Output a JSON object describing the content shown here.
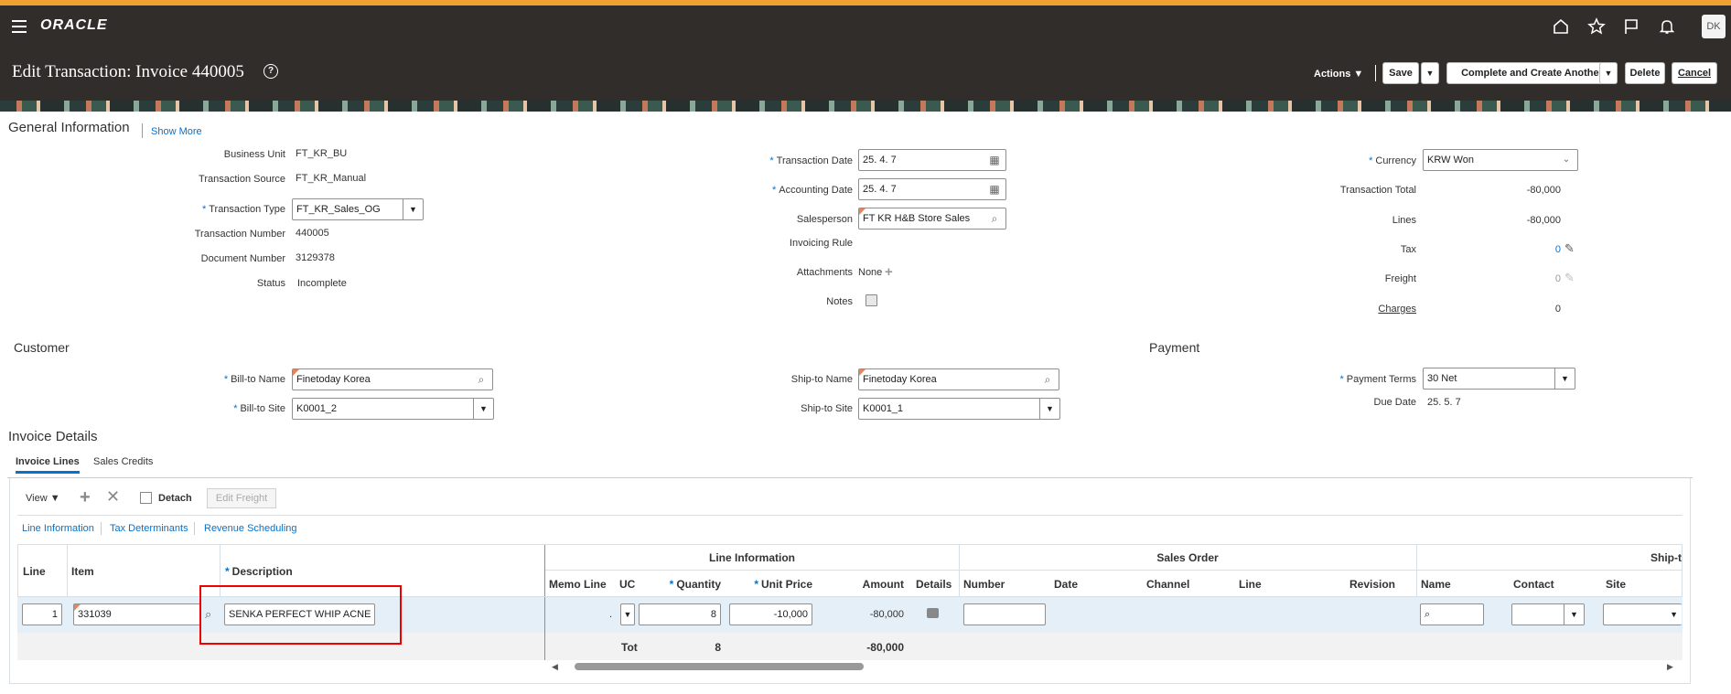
{
  "nav": {
    "logo": "ORACLE",
    "avatar": "DK",
    "icons": [
      "home-icon",
      "star-icon",
      "flag-icon",
      "bell-icon"
    ]
  },
  "header": {
    "title": "Edit Transaction: Invoice 440005",
    "help_glyph": "?",
    "actions_label": "Actions ▼",
    "save": "Save",
    "complete_create": "Complete and Create Another",
    "delete": "Delete",
    "cancel": "Cancel"
  },
  "general": {
    "heading": "General Information",
    "show_more": "Show More",
    "business_unit_label": "Business Unit",
    "business_unit": "FT_KR_BU",
    "transaction_source_label": "Transaction Source",
    "transaction_source": "FT_KR_Manual",
    "transaction_type_label": "Transaction Type",
    "transaction_type": "FT_KR_Sales_OG",
    "transaction_number_label": "Transaction Number",
    "transaction_number": "440005",
    "document_number_label": "Document Number",
    "document_number": "3129378",
    "status_label": "Status",
    "status": "Incomplete",
    "transaction_date_label": "Transaction Date",
    "transaction_date": "25. 4. 7",
    "accounting_date_label": "Accounting Date",
    "accounting_date": "25. 4. 7",
    "salesperson_label": "Salesperson",
    "salesperson": "FT KR H&B Store Sales",
    "invoicing_rule_label": "Invoicing Rule",
    "attachments_label": "Attachments",
    "attachments": "None",
    "notes_label": "Notes",
    "currency_label": "Currency",
    "currency": "KRW Won",
    "transaction_total_label": "Transaction Total",
    "transaction_total": "-80,000",
    "lines_label": "Lines",
    "lines": "-80,000",
    "tax_label": "Tax",
    "tax": "0",
    "freight_label": "Freight",
    "freight": "0",
    "charges_label": "Charges",
    "charges": "0"
  },
  "customer": {
    "heading": "Customer",
    "bill_to_name_label": "Bill-to Name",
    "bill_to_name": "Finetoday Korea",
    "bill_to_site_label": "Bill-to Site",
    "bill_to_site": "K0001_2",
    "ship_to_name_label": "Ship-to Name",
    "ship_to_name": "Finetoday Korea",
    "ship_to_site_label": "Ship-to Site",
    "ship_to_site": "K0001_1"
  },
  "payment": {
    "heading": "Payment",
    "terms_label": "Payment Terms",
    "terms": "30 Net",
    "due_date_label": "Due Date",
    "due_date": "25. 5. 7"
  },
  "details": {
    "heading": "Invoice Details",
    "tabs": [
      "Invoice Lines",
      "Sales Credits"
    ],
    "view": "View ▼",
    "detach": "Detach",
    "edit_freight": "Edit Freight",
    "links": [
      "Line Information",
      "Tax Determinants",
      "Revenue Scheduling"
    ],
    "groups": {
      "line_information": "Line Information",
      "sales_order": "Sales Order",
      "ship_to": "Ship-t"
    },
    "columns": {
      "line": "Line",
      "item": "Item",
      "description": "Description",
      "memo_line": "Memo Line",
      "uom": "UC",
      "quantity": "Quantity",
      "unit_price": "Unit Price",
      "amount": "Amount",
      "details": "Details",
      "number": "Number",
      "date": "Date",
      "channel": "Channel",
      "so_line": "Line",
      "revision": "Revision",
      "name": "Name",
      "contact": "Contact",
      "site": "Site"
    },
    "row": {
      "line": "1",
      "item": "331039",
      "description": "SENKA PERFECT WHIP ACNE",
      "memo_dot": ".",
      "quantity": "8",
      "unit_price": "-10,000",
      "amount": "-80,000"
    },
    "totals": {
      "label": "Tot",
      "quantity": "8",
      "amount": "-80,000"
    }
  }
}
